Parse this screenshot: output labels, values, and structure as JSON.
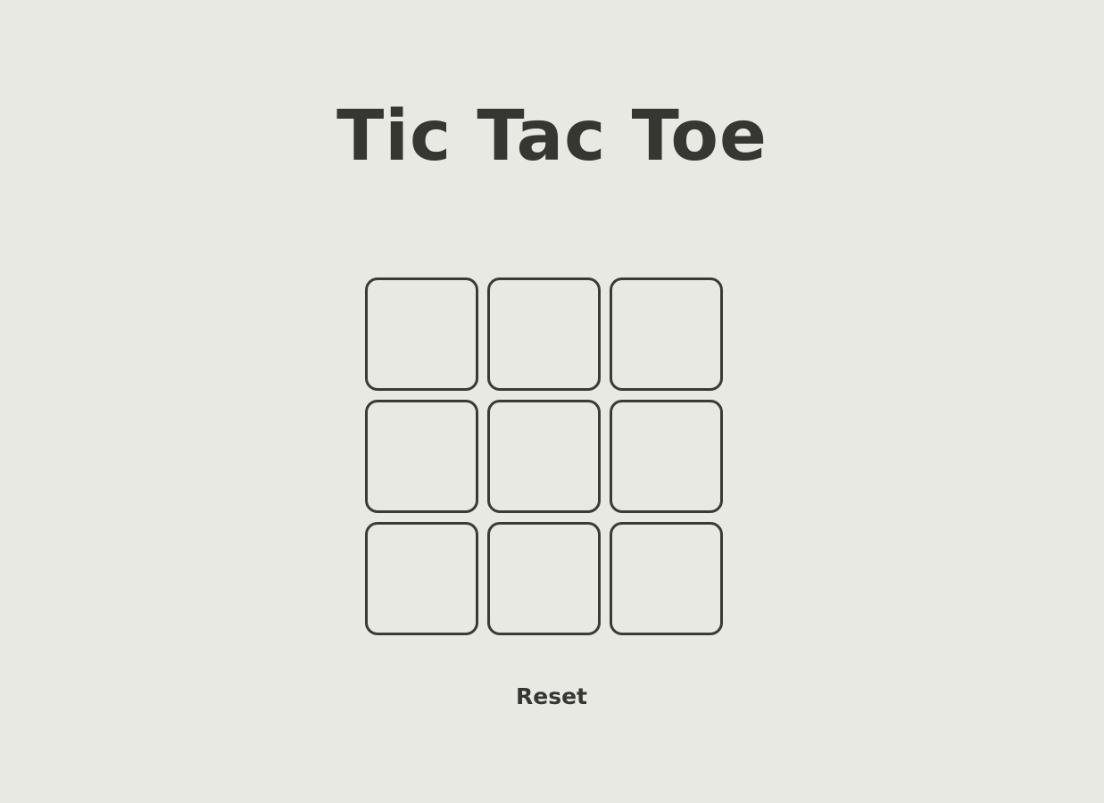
{
  "page": {
    "title": "Tic Tac Toe"
  },
  "board": {
    "cells": [
      "",
      "",
      "",
      "",
      "",
      "",
      "",
      "",
      ""
    ]
  },
  "controls": {
    "reset_label": "Reset"
  },
  "colors": {
    "background": "#e9e9e4",
    "text": "#363633",
    "cell_border": "#3a3a37"
  }
}
